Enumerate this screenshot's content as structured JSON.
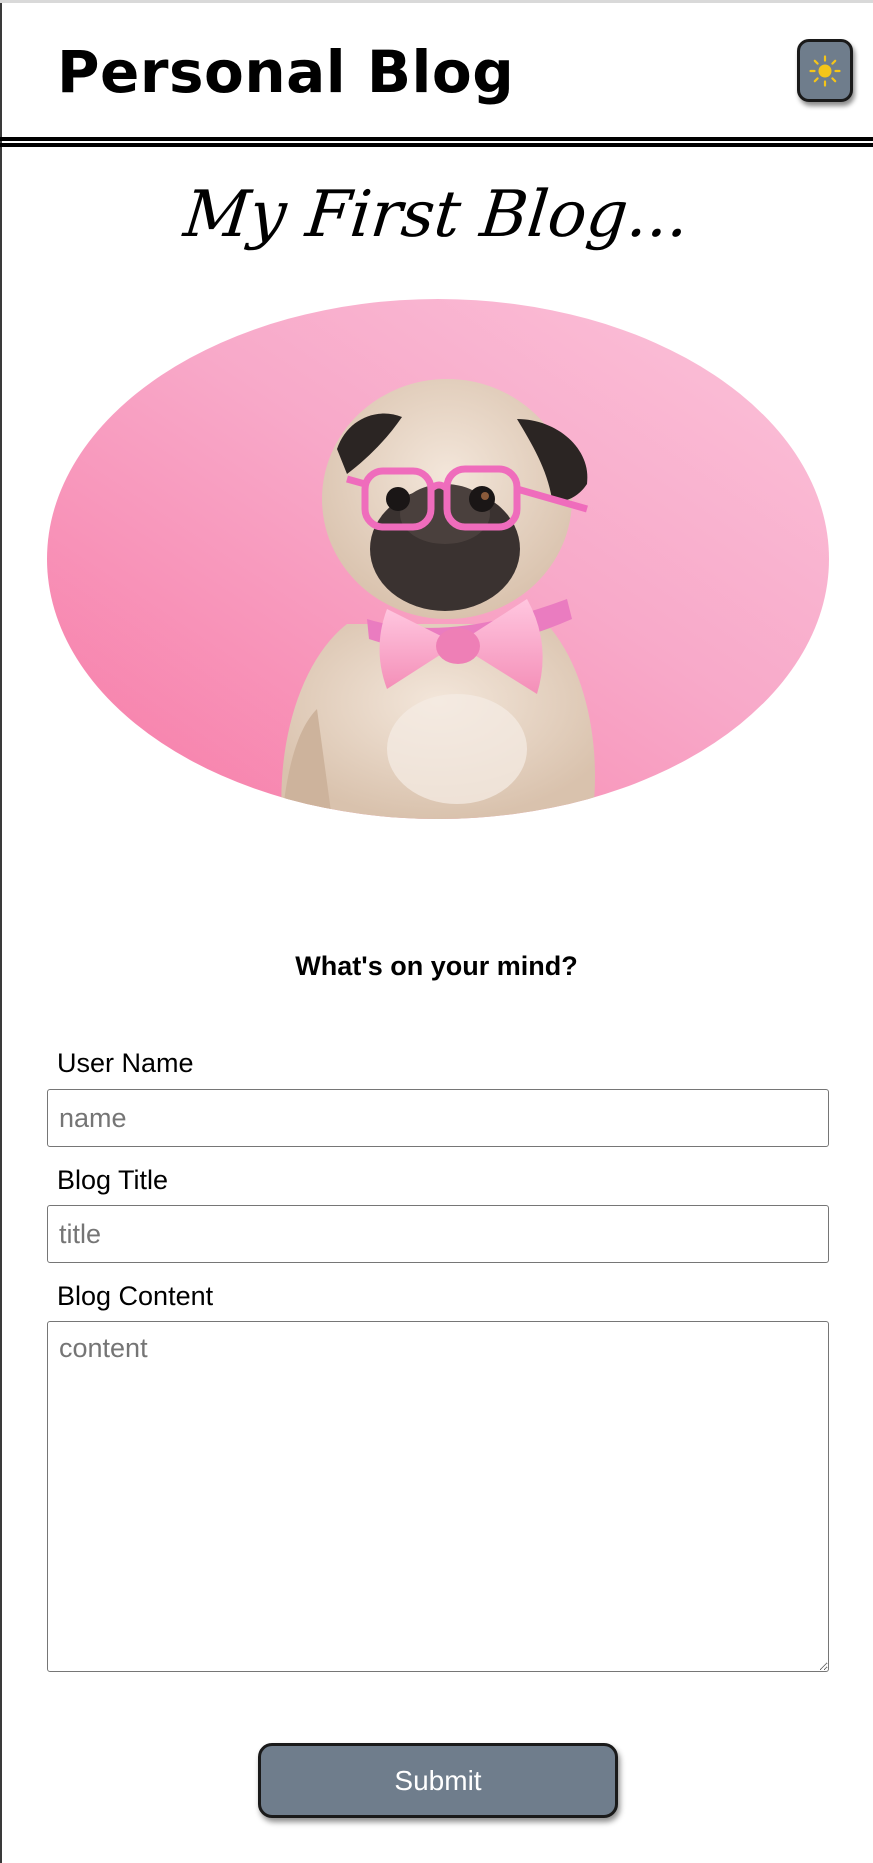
{
  "header": {
    "title": "Personal Blog",
    "theme_toggle_icon": "sun-icon",
    "icon_color": "#f5c518"
  },
  "hero": {
    "heading": "My First Blog...",
    "image_description": "pug-wearing-pink-glasses-and-bow-tie"
  },
  "form": {
    "prompt": "What's on your mind?",
    "username": {
      "label": "User Name",
      "value": "",
      "placeholder": "name"
    },
    "title": {
      "label": "Blog Title",
      "value": "",
      "placeholder": "title"
    },
    "content": {
      "label": "Blog Content",
      "value": "",
      "placeholder": "content"
    },
    "submit_label": "Submit"
  },
  "colors": {
    "button_bg": "#6f7d8c",
    "background": "#ffffff",
    "hero_pink": "#f7a6c8"
  }
}
